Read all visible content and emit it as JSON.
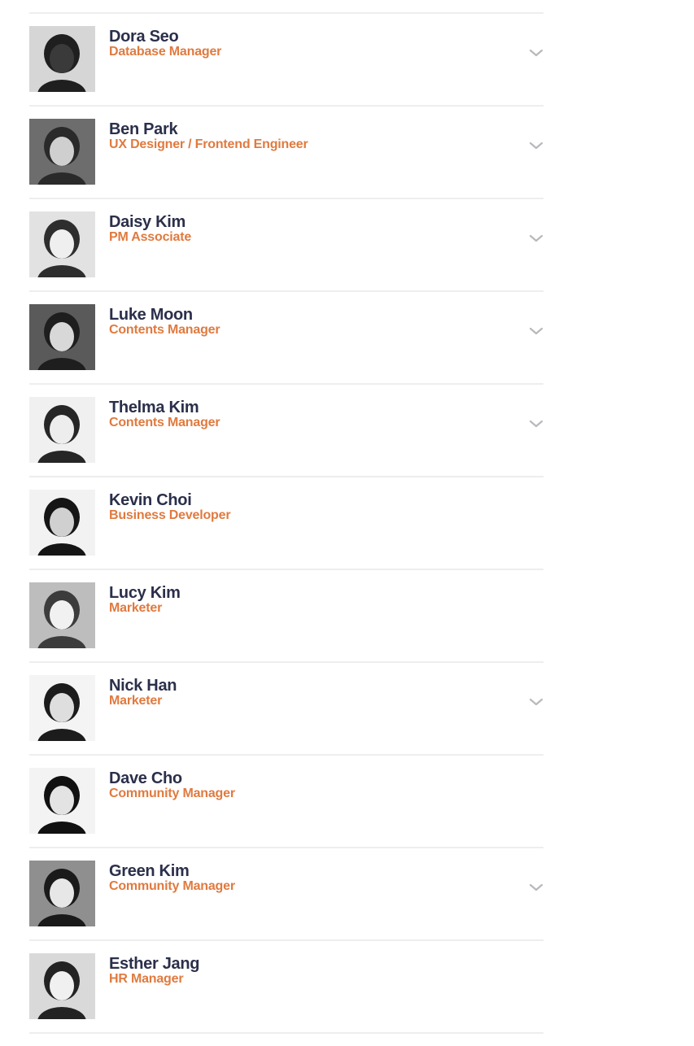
{
  "team": [
    {
      "name": "Dora Seo",
      "role": "Database Manager",
      "expandable": true
    },
    {
      "name": "Ben Park",
      "role": "UX Designer / Frontend Engineer",
      "expandable": true
    },
    {
      "name": "Daisy Kim",
      "role": "PM Associate",
      "expandable": true
    },
    {
      "name": "Luke Moon",
      "role": "Contents Manager",
      "expandable": true
    },
    {
      "name": "Thelma Kim",
      "role": "Contents Manager",
      "expandable": true
    },
    {
      "name": "Kevin Choi",
      "role": "Business Developer",
      "expandable": false
    },
    {
      "name": "Lucy Kim",
      "role": "Marketer",
      "expandable": false
    },
    {
      "name": "Nick Han",
      "role": "Marketer",
      "expandable": true
    },
    {
      "name": "Dave Cho",
      "role": "Community Manager",
      "expandable": false
    },
    {
      "name": "Green Kim",
      "role": "Community Manager",
      "expandable": true
    },
    {
      "name": "Esther Jang",
      "role": "HR Manager",
      "expandable": false
    }
  ],
  "colors": {
    "name": "#2b2f4a",
    "role": "#e07a3f",
    "chevron": "#b9b9bd",
    "divider": "#eeeef0"
  },
  "icons": {
    "chevron": "chevron-down-icon",
    "avatar": "profile-photo"
  }
}
